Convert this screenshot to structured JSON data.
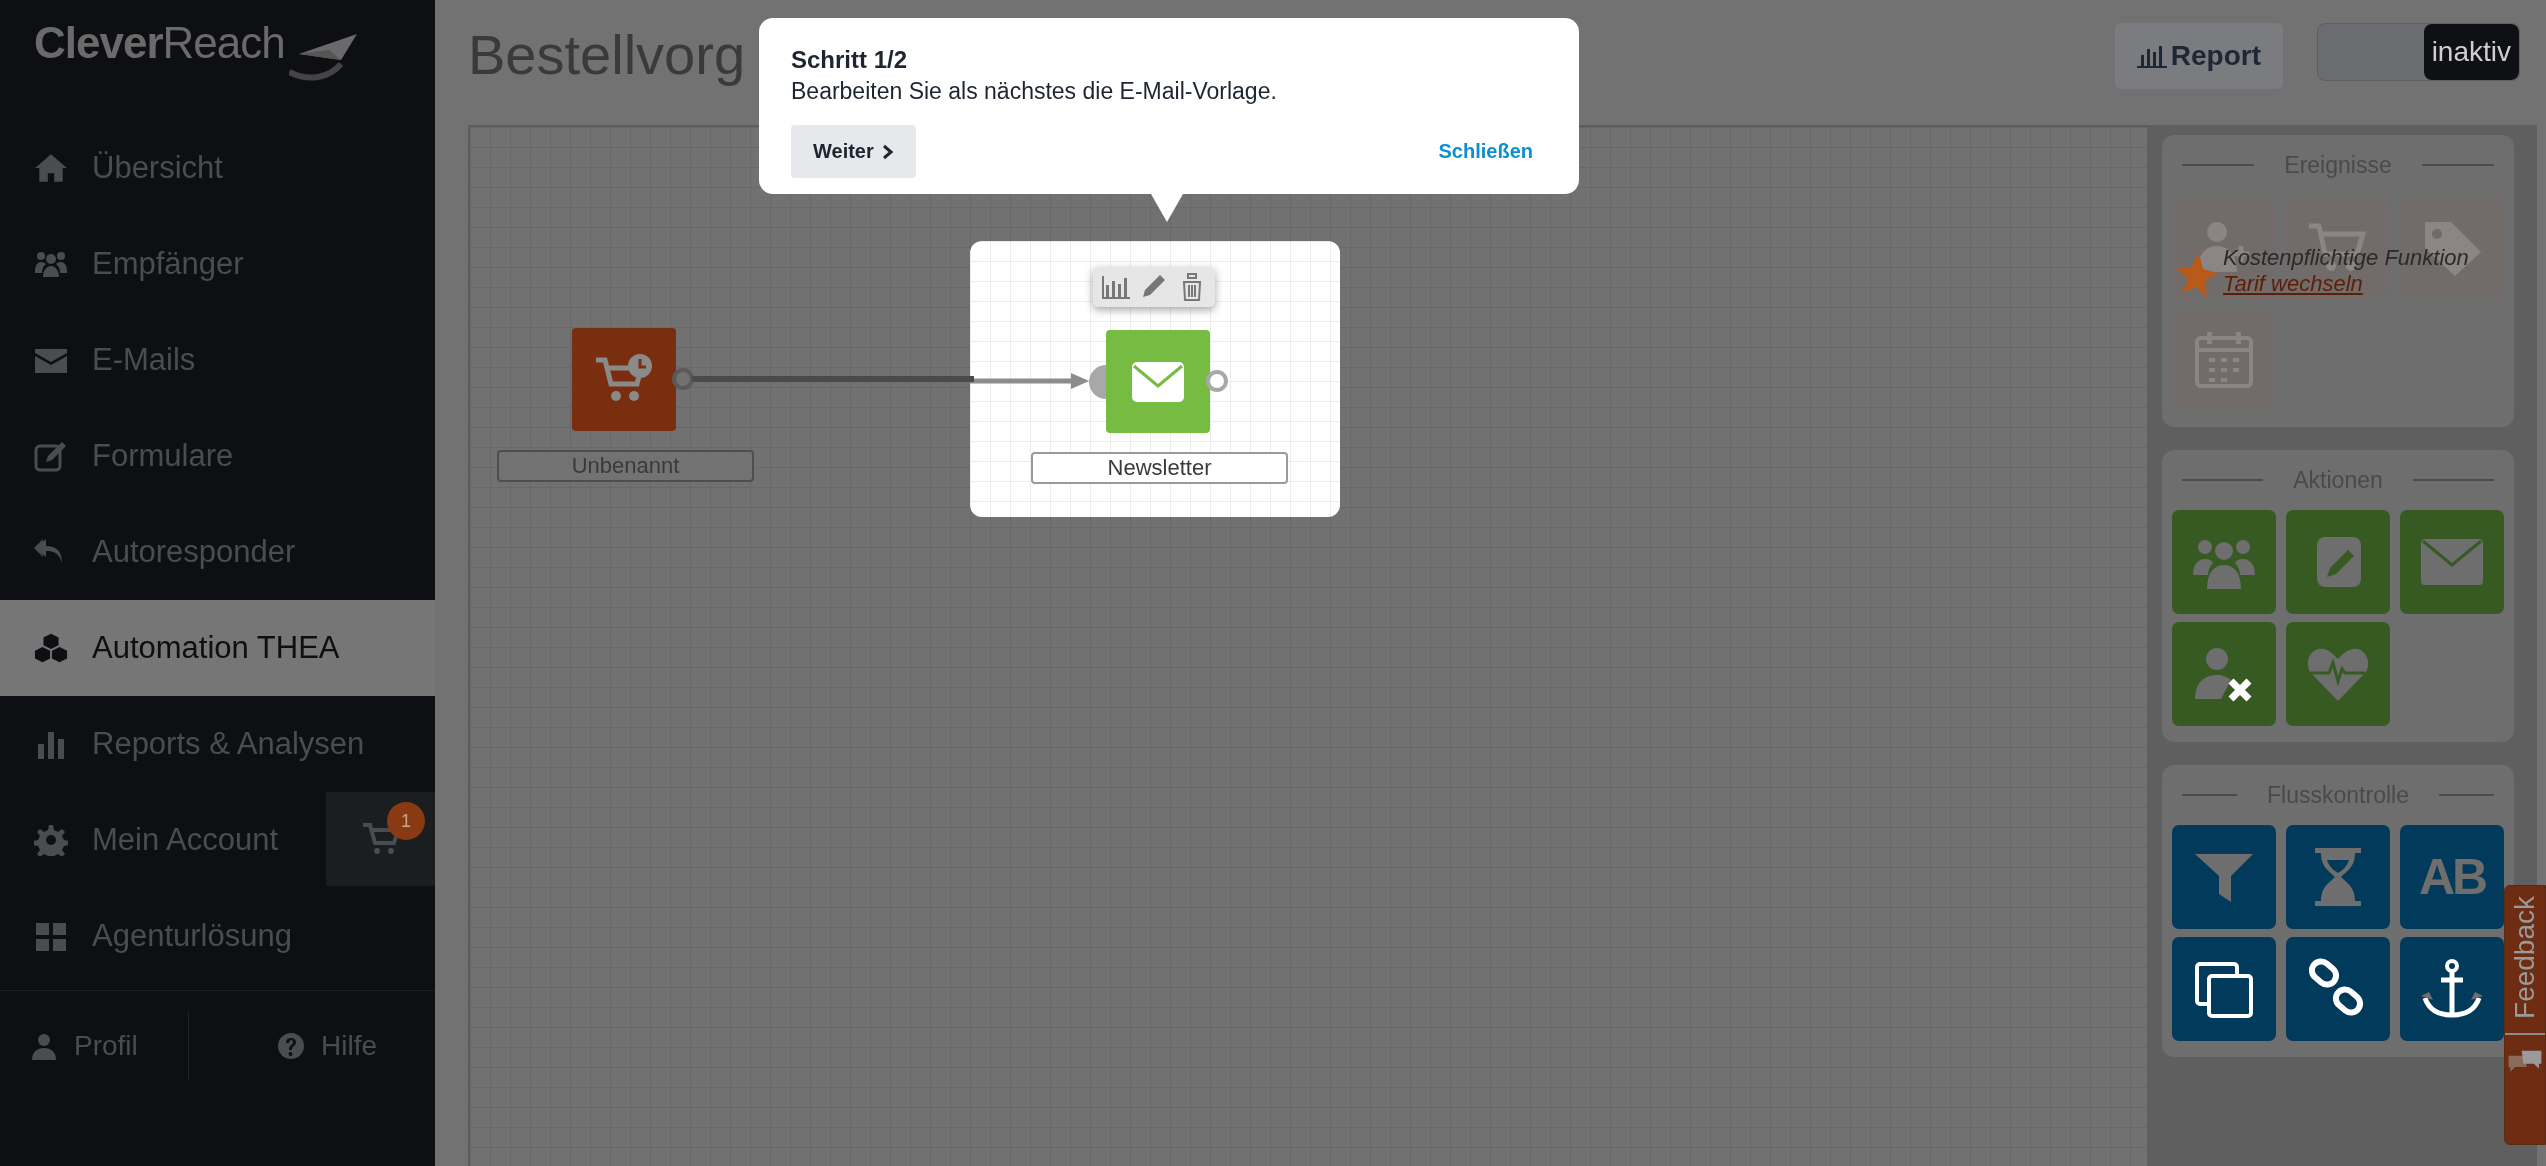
{
  "logo": {
    "text": "**Clever**Reach"
  },
  "sidebar": {
    "items": [
      {
        "label": "Übersicht",
        "selected": false
      },
      {
        "label": "Empfänger",
        "selected": false
      },
      {
        "label": "E-Mails",
        "selected": false
      },
      {
        "label": "Formulare",
        "selected": false
      },
      {
        "label": "Autoresponder",
        "selected": false
      },
      {
        "label": "Automation THEA",
        "selected": true
      },
      {
        "label": "Reports & Analysen",
        "selected": false
      },
      {
        "label": "Mein Account",
        "selected": false,
        "cart_badge": "1"
      },
      {
        "label": "Agenturlösung",
        "selected": false
      }
    ],
    "footer": [
      {
        "label": "Profil"
      },
      {
        "label": "Hilfe"
      }
    ]
  },
  "header": {
    "title": "Bestellvorg",
    "report_button": "Report",
    "toggle": {
      "label": "inaktiv",
      "on": false
    }
  },
  "canvas": {
    "nodes": [
      {
        "kind": "trigger",
        "label": "Unbenannt",
        "highlighted": false
      },
      {
        "kind": "email",
        "label": "Newsletter",
        "highlighted": true
      }
    ]
  },
  "tour": {
    "title": "Schritt 1/2",
    "text": "Bearbeiten Sie als nächstes die E-Mail-Vorlage.",
    "next_button": "Weiter",
    "close_link": "Schließen"
  },
  "palette": {
    "sections": [
      {
        "kind": "event",
        "title": "Ereignisse",
        "disabled": true,
        "notice": {
          "text": "Kostenpflichtige Funktion",
          "link": "Tarif wechseln"
        }
      },
      {
        "kind": "action",
        "title": "Aktionen",
        "disabled": false
      },
      {
        "kind": "flow",
        "title": "Flusskontrolle",
        "disabled": false,
        "split_label": "AB"
      }
    ]
  },
  "feedback_tab": {
    "label": "Feedback"
  }
}
